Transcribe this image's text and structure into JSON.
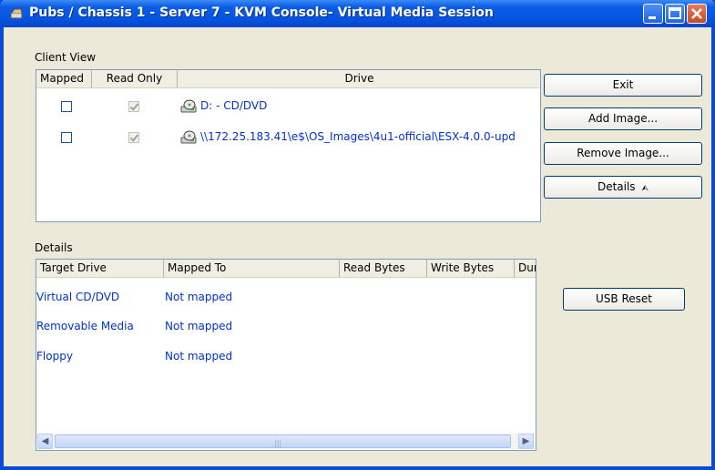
{
  "window": {
    "title": "Pubs / Chassis 1 - Server 7 - KVM Console- Virtual Media Session"
  },
  "client_view": {
    "label": "Client View",
    "columns": [
      "Mapped",
      "Read Only",
      "Drive"
    ],
    "rows": [
      {
        "mapped": false,
        "read_only": true,
        "drive": "D: - CD/DVD"
      },
      {
        "mapped": false,
        "read_only": true,
        "drive": "\\\\172.25.183.41\\e$\\OS_Images\\4u1-official\\ESX-4.0.0-upd"
      }
    ]
  },
  "buttons": {
    "exit": "Exit",
    "add_image": "Add Image...",
    "remove_image": "Remove Image...",
    "details": "Details",
    "details_arrow": "⮙",
    "usb_reset": "USB Reset"
  },
  "details": {
    "label": "Details",
    "columns": [
      "Target Drive",
      "Mapped To",
      "Read Bytes",
      "Write Bytes",
      "Dur"
    ],
    "rows": [
      {
        "target": "Virtual CD/DVD",
        "mapped_to": "Not mapped"
      },
      {
        "target": "Removable Media",
        "mapped_to": "Not mapped"
      },
      {
        "target": "Floppy",
        "mapped_to": "Not mapped"
      }
    ]
  },
  "icons": {
    "title": "window-app-icon",
    "drive": "cd-drive-icon",
    "scroll_left": "◀",
    "scroll_right": "▶",
    "grip": "|||"
  }
}
